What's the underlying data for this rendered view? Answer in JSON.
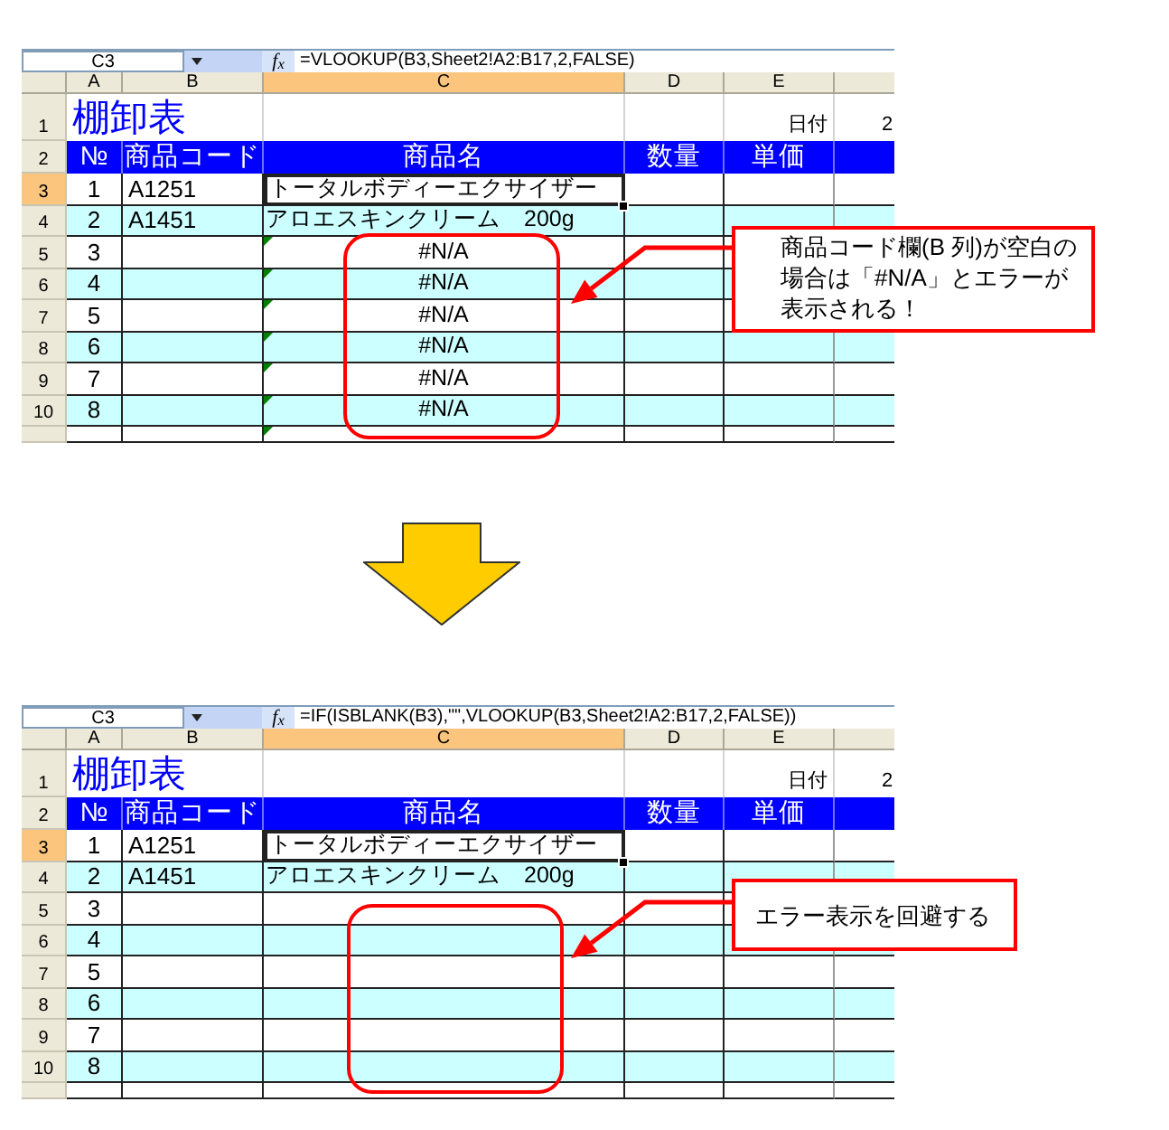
{
  "sheets": [
    {
      "name_box": "C3",
      "function_label": "f$_{x}$",
      "formula": "=VLOOKUP(B3,Sheet2!A2:B17,2,FALSE)",
      "columns": [
        {
          "label": "A",
          "selected": false
        },
        {
          "label": "B",
          "selected": false
        },
        {
          "label": "C",
          "selected": true
        },
        {
          "label": "D",
          "selected": false
        },
        {
          "label": "E",
          "selected": false
        }
      ],
      "rows": [
        {
          "kind": "title",
          "label": "1",
          "selected": false,
          "title": "棚卸表",
          "date_label": "日付",
          "date_value": "2"
        },
        {
          "kind": "header",
          "label": "2",
          "selected": false,
          "cells": [
            "№",
            "商品コード",
            "商品名",
            "数量",
            "単価"
          ]
        },
        {
          "kind": "item",
          "label": "3",
          "selected": true,
          "shaded": false,
          "error_indicator": false,
          "no": "1",
          "code": "A1251",
          "name": "トータルボディーエクサイザー"
        },
        {
          "kind": "item",
          "label": "4",
          "selected": false,
          "shaded": true,
          "error_indicator": false,
          "no": "2",
          "code": "A1451",
          "name": "アロエスキンクリーム　200g"
        },
        {
          "kind": "item",
          "label": "5",
          "selected": false,
          "shaded": false,
          "error_indicator": true,
          "no": "3",
          "name": "#N/A"
        },
        {
          "kind": "item",
          "label": "6",
          "selected": false,
          "shaded": true,
          "error_indicator": true,
          "no": "4",
          "name": "#N/A"
        },
        {
          "kind": "item",
          "label": "7",
          "selected": false,
          "shaded": false,
          "error_indicator": true,
          "no": "5",
          "name": "#N/A"
        },
        {
          "kind": "item",
          "label": "8",
          "selected": false,
          "shaded": true,
          "error_indicator": true,
          "no": "6",
          "name": "#N/A"
        },
        {
          "kind": "item",
          "label": "9",
          "selected": false,
          "shaded": false,
          "error_indicator": true,
          "no": "7",
          "name": "#N/A"
        },
        {
          "kind": "item",
          "label": "10",
          "selected": false,
          "shaded": true,
          "error_indicator": true,
          "no": "8",
          "name": "#N/A"
        },
        {
          "kind": "cut",
          "selected": false,
          "shaded": false,
          "error_indicator": true
        }
      ],
      "callout": {
        "lines": [
          "商品コード欄(B 列)が空白の",
          "場合は「#N/A」とエラーが",
          "表示される！"
        ]
      }
    },
    {
      "name_box": "C3",
      "function_label": "f$_{x}$",
      "formula": "=IF(ISBLANK(B3),\"\",VLOOKUP(B3,Sheet2!A2:B17,2,FALSE))",
      "columns": [
        {
          "label": "A",
          "selected": false
        },
        {
          "label": "B",
          "selected": false
        },
        {
          "label": "C",
          "selected": true
        },
        {
          "label": "D",
          "selected": false
        },
        {
          "label": "E",
          "selected": false
        }
      ],
      "rows": [
        {
          "kind": "title",
          "label": "1",
          "selected": false,
          "title": "棚卸表",
          "date_label": "日付",
          "date_value": "2"
        },
        {
          "kind": "header",
          "label": "2",
          "selected": false,
          "cells": [
            "№",
            "商品コード",
            "商品名",
            "数量",
            "単価"
          ]
        },
        {
          "kind": "item",
          "label": "3",
          "selected": true,
          "shaded": false,
          "error_indicator": false,
          "no": "1",
          "code": "A1251",
          "name": "トータルボディーエクサイザー"
        },
        {
          "kind": "item",
          "label": "4",
          "selected": false,
          "shaded": true,
          "error_indicator": false,
          "no": "2",
          "code": "A1451",
          "name": "アロエスキンクリーム　200g"
        },
        {
          "kind": "item",
          "label": "5",
          "selected": false,
          "shaded": false,
          "error_indicator": false,
          "no": "3"
        },
        {
          "kind": "item",
          "label": "6",
          "selected": false,
          "shaded": true,
          "error_indicator": false,
          "no": "4"
        },
        {
          "kind": "item",
          "label": "7",
          "selected": false,
          "shaded": false,
          "error_indicator": false,
          "no": "5"
        },
        {
          "kind": "item",
          "label": "8",
          "selected": false,
          "shaded": true,
          "error_indicator": false,
          "no": "6"
        },
        {
          "kind": "item",
          "label": "9",
          "selected": false,
          "shaded": false,
          "error_indicator": false,
          "no": "7"
        },
        {
          "kind": "item",
          "label": "10",
          "selected": false,
          "shaded": true,
          "error_indicator": false,
          "no": "8"
        },
        {
          "kind": "cut",
          "selected": false,
          "shaded": false,
          "error_indicator": false
        }
      ],
      "callout": {
        "lines": [
          "エラー表示を回避する"
        ]
      }
    }
  ]
}
